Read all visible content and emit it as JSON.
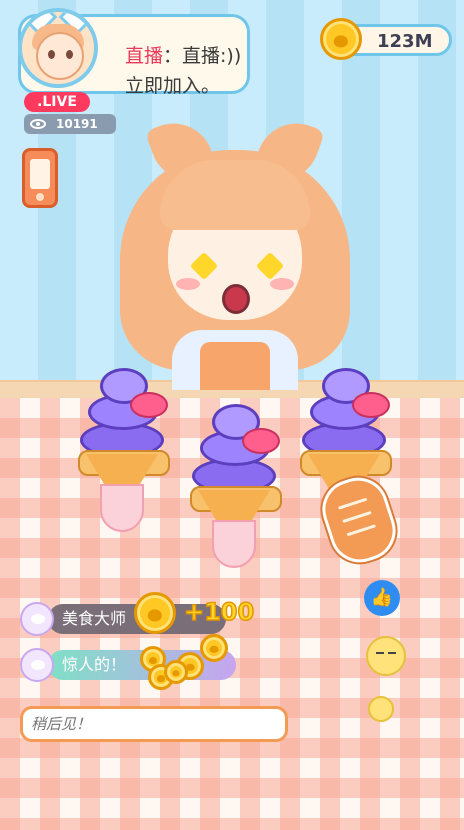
{
  "streamer": {
    "title_prefix": "直播",
    "title_sep": "：",
    "title_suffix": "直播:))",
    "subtitle": "立即加入。"
  },
  "live_badge": ".LIVE",
  "viewers": {
    "icon": "eye-icon",
    "count": "10191"
  },
  "coins": {
    "icon": "paw-coin-icon",
    "amount": "123M"
  },
  "reward": {
    "text": "+100"
  },
  "chat": {
    "messages": [
      {
        "avatar": "cat-avatar",
        "text": "美食大师"
      },
      {
        "avatar": "cat-avatar",
        "text": "惊人的！"
      }
    ],
    "input_placeholder": "稍后见！"
  },
  "reactions": [
    "thumbs-up-icon",
    "sleepy-face-icon",
    "angel-face-icon"
  ],
  "colors": {
    "accent_blue": "#6fc6ea",
    "live_red": "#ff3a5e",
    "coin_gold": "#ffc824",
    "input_orange": "#f39b54"
  }
}
